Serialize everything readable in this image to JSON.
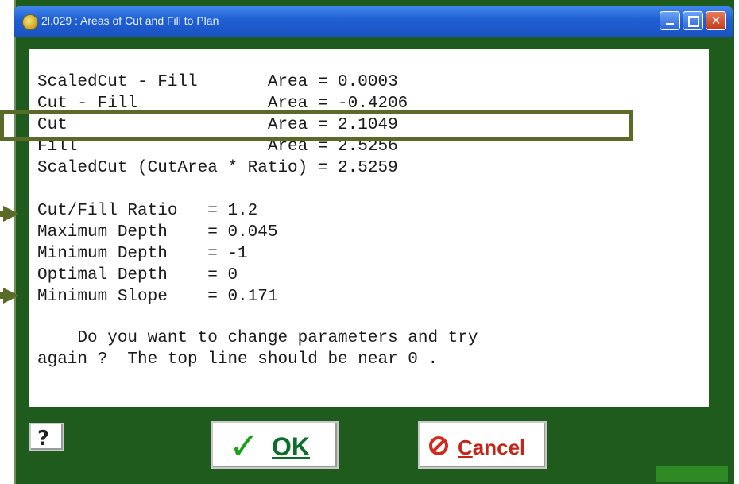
{
  "window": {
    "title": "2l.029 : Areas of Cut and Fill to Plan"
  },
  "results_text": "ScaledCut - Fill       Area = 0.0003\nCut - Fill             Area = -0.4206\nCut                    Area = 2.1049\nFill                   Area = 2.5256\nScaledCut (CutArea * Ratio) = 2.5259",
  "params_text": "Cut/Fill Ratio   = 1.2\nMaximum Depth    = 0.045\nMinimum Depth    = -1\nOptimal Depth    = 0\nMinimum Slope    = 0.171",
  "question_text": "    Do you want to change parameters and try\nagain ?  The top line should be near 0 .",
  "buttons": {
    "help_glyph": "?",
    "ok_check": "✓",
    "ok_label": "OK",
    "cancel_label": "Cancel"
  },
  "colors": {
    "frame": "#1f5b1c",
    "highlight": "#5a6b28",
    "ok_check": "#1aa31a",
    "cancel": "#d22a1f"
  },
  "icons": [
    "app-icon",
    "minimize-icon",
    "maximize-icon",
    "close-icon",
    "help-icon",
    "check-icon",
    "cancel-icon"
  ]
}
